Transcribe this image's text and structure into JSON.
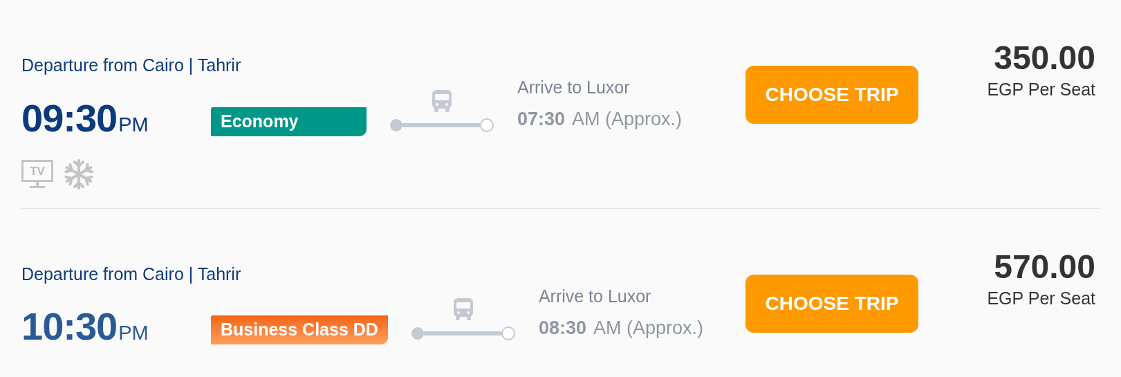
{
  "trips": [
    {
      "departure": "Departure from Cairo | Tahrir",
      "time": "09:30",
      "period": "PM",
      "class": {
        "label": "Economy",
        "kind": "economy"
      },
      "arrival_label": "Arrive to Luxor",
      "arrival_time": "07:30",
      "arrival_period": "AM (Approx.)",
      "button": "CHOOSE TRIP",
      "price": "350.00",
      "price_unit": "EGP Per Seat",
      "amenities": [
        {
          "kind": "tv",
          "label": "TV"
        },
        {
          "kind": "ac"
        }
      ]
    },
    {
      "departure": "Departure from Cairo | Tahrir",
      "time": "10:30",
      "period": "PM",
      "class": {
        "label": "Business Class DD",
        "kind": "business"
      },
      "arrival_label": "Arrive to Luxor",
      "arrival_time": "08:30",
      "arrival_period": "AM (Approx.)",
      "button": "CHOOSE TRIP",
      "price": "570.00",
      "price_unit": "EGP Per Seat"
    }
  ]
}
